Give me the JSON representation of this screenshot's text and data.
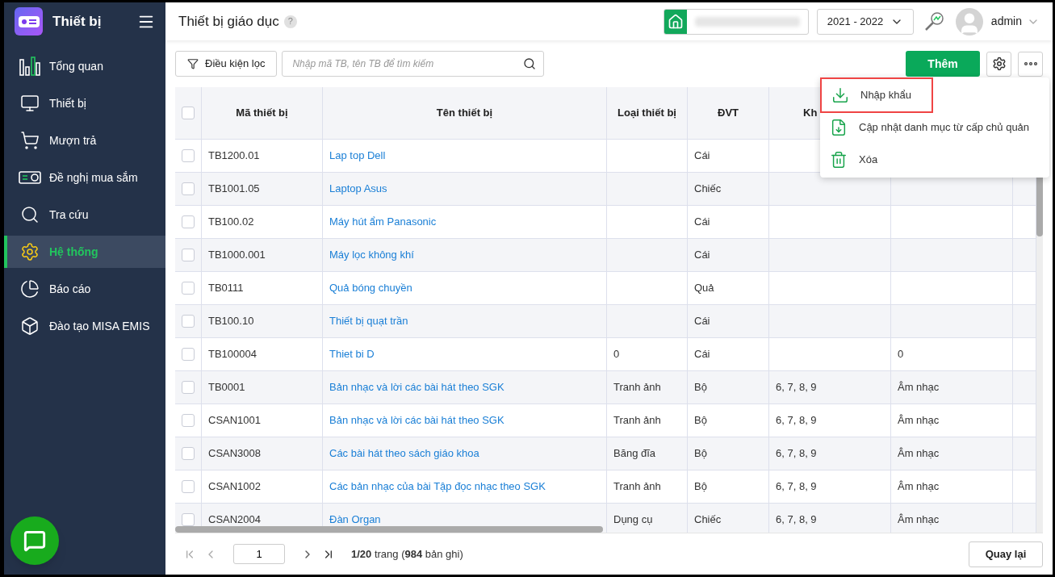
{
  "app": {
    "title": "Thiết bị"
  },
  "sidebar": {
    "items": [
      {
        "label": "Tổng quan",
        "kind": "overview",
        "selected": false
      },
      {
        "label": "Thiết bị",
        "kind": "device",
        "selected": false
      },
      {
        "label": "Mượn trả",
        "kind": "cart",
        "selected": false
      },
      {
        "label": "Đề nghị mua sắm",
        "kind": "projector",
        "selected": false
      },
      {
        "label": "Tra cứu",
        "kind": "lookup",
        "selected": false
      },
      {
        "label": "Hệ thống",
        "kind": "system",
        "selected": true
      },
      {
        "label": "Báo cáo",
        "kind": "report",
        "selected": false
      },
      {
        "label": "Đào tạo MISA EMIS",
        "kind": "training",
        "selected": false
      }
    ]
  },
  "header": {
    "page_title": "Thiết bị giáo dục",
    "help": "?",
    "school_year": "2021 - 2022",
    "user": "admin"
  },
  "toolbar": {
    "filter_button": "Điều kiện lọc",
    "search": {
      "placeholder": "Nhập mã TB, tên TB để tìm kiếm"
    },
    "add_button": "Thêm"
  },
  "menu": {
    "items": [
      {
        "label": "Nhập khẩu",
        "kind": "import",
        "highlighted": true
      },
      {
        "label": "Cập nhật danh mục từ cấp chủ quản",
        "kind": "update",
        "highlighted": false
      },
      {
        "label": "Xóa",
        "kind": "delete",
        "highlighted": false
      }
    ]
  },
  "table": {
    "all_checked": false,
    "columns": [
      "Mã thiết bị",
      "Tên thiết bị",
      "Loại thiết bị",
      "ĐVT",
      "Kh"
    ],
    "rows": [
      {
        "checked": false,
        "code": "TB1200.01",
        "name": "Lap top Dell",
        "unit": "Cái"
      },
      {
        "checked": false,
        "code": "TB1001.05",
        "name": "Laptop Asus",
        "unit": "Chiếc"
      },
      {
        "checked": false,
        "code": "TB100.02",
        "name": "Máy hút ẩm Panasonic",
        "unit": "Cái"
      },
      {
        "checked": false,
        "code": "TB1000.001",
        "name": "Máy lọc không khí",
        "unit": "Cái"
      },
      {
        "checked": false,
        "code": "TB0111",
        "name": "Quả bóng chuyền",
        "unit": "Quả"
      },
      {
        "checked": false,
        "code": "TB100.10",
        "name": "Thiết bị quạt trần",
        "unit": "Cái"
      },
      {
        "checked": false,
        "code": "TB100004",
        "name": "Thiet bi D",
        "category": "0",
        "unit": "Cái",
        "column_6": "0"
      },
      {
        "checked": false,
        "code": "TB0001",
        "name": "Bản nhạc và lời các bài hát theo SGK",
        "category": "Tranh ảnh",
        "unit": "Bộ",
        "column_5": "6, 7, 8, 9",
        "column_6": "Âm nhạc"
      },
      {
        "checked": false,
        "code": "CSAN1001",
        "name": "Bản nhạc và lời các bài hát theo SGK",
        "category": "Tranh ảnh",
        "unit": "Bộ",
        "column_5": "6, 7, 8, 9",
        "column_6": "Âm nhạc"
      },
      {
        "checked": false,
        "code": "CSAN3008",
        "name": "Các bài hát theo sách giáo khoa",
        "category": "Băng đĩa",
        "unit": "Bộ",
        "column_5": "6, 7, 8, 9",
        "column_6": "Âm nhạc"
      },
      {
        "checked": false,
        "code": "CSAN1002",
        "name": "Các bản nhạc của bài Tập đọc nhạc theo SGK",
        "category": "Tranh ảnh",
        "unit": "Bộ",
        "column_5": "6, 7, 8, 9",
        "column_6": "Âm nhạc"
      },
      {
        "checked": false,
        "code": "CSAN2004",
        "name": "Đàn Organ",
        "category": "Dụng cụ",
        "unit": "Chiếc",
        "column_5": "6, 7, 8, 9",
        "column_6": "Âm nhạc"
      }
    ]
  },
  "pagination": {
    "page": "1",
    "summary": "**1/20** trang (**984** bản ghi)",
    "back_button": "Quay lại"
  }
}
